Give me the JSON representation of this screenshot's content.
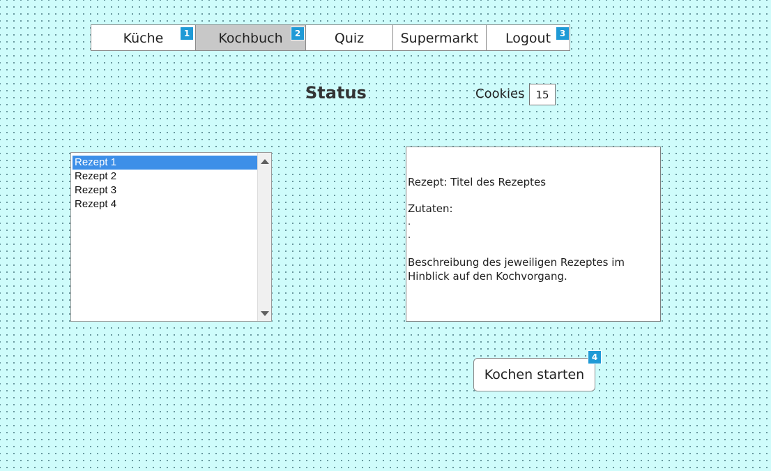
{
  "nav": {
    "items": [
      {
        "label": "Küche",
        "badge": "1"
      },
      {
        "label": "Kochbuch",
        "badge": "2"
      },
      {
        "label": "Quiz",
        "badge": ""
      },
      {
        "label": "Supermarkt",
        "badge": ""
      },
      {
        "label": "Logout",
        "badge": "3"
      }
    ],
    "active": "Kochbuch"
  },
  "status": {
    "title": "Status",
    "cookies_label": "Cookies",
    "cookies_value": "15"
  },
  "recipe_list": {
    "items": [
      "Rezept 1",
      "Rezept 2",
      "Rezept 3",
      "Rezept 4"
    ],
    "selected": "Rezept 1"
  },
  "recipe_detail": {
    "title_line": "Rezept: Titel des Rezeptes",
    "ingredients_label": "Zutaten:",
    "bullet_1": ".",
    "bullet_2": ".",
    "description": "Beschreibung des jeweiligen Rezeptes im Hinblick auf den Kochvorgang."
  },
  "cook_button": {
    "label": "Kochen starten",
    "badge": "4"
  },
  "colors": {
    "background": "#cffcfb",
    "badge": "#1f9ad6",
    "selection": "#3d8fe8",
    "active_tab": "#c8c8c8"
  }
}
